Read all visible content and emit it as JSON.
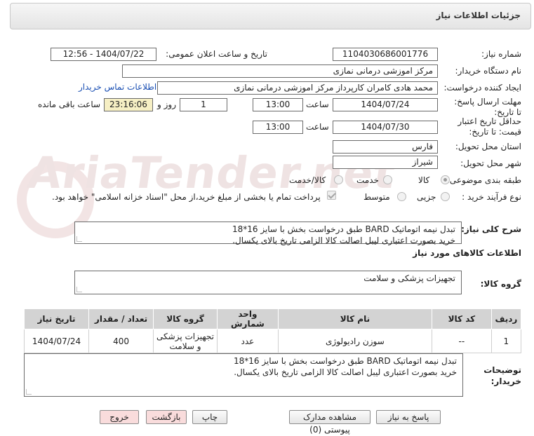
{
  "header": {
    "title": "جزئیات اطلاعات نیاز"
  },
  "watermark": {
    "text": "AriaTender.net"
  },
  "fields": {
    "need_number_label": "شماره نیاز:",
    "need_number": "1104030686001776",
    "announce_label": "تاریخ و ساعت اعلان عمومی:",
    "announce_value": "1404/07/22 - 12:56",
    "buyer_org_label": "نام دستگاه خریدار:",
    "buyer_org": "مرکز اموزشی درمانی نمازی",
    "creator_label": "ایجاد کننده درخواست:",
    "creator": "محمد هادی کامران کارپرداز مرکز اموزشی درمانی نمازی",
    "contact_link": "اطلاعات تماس خریدار",
    "reply_deadline_label": "مهلت ارسال پاسخ: تا تاریخ:",
    "reply_date": "1404/07/24",
    "time_label": "ساعت",
    "reply_time": "13:00",
    "days_value": "1",
    "days_label": "روز و",
    "remaining_time": "23:16:06",
    "remaining_label": "ساعت باقی مانده",
    "validity_label": "حداقل تاریخ اعتبار قیمت: تا تاریخ:",
    "validity_date": "1404/07/30",
    "validity_time": "13:00",
    "province_label": "استان محل تحویل:",
    "province": "فارس",
    "city_label": "شهر محل تحویل:",
    "city": "شیراز",
    "category_label": "طبقه بندی موضوعی:",
    "category_options": [
      "کالا",
      "خدمت",
      "کالا/خدمت"
    ],
    "process_label": "نوع فرآیند خرید :",
    "process_options": [
      "جزیی",
      "متوسط"
    ],
    "payment_note": "پرداخت تمام یا بخشی از مبلغ خرید،از محل \"اسناد خزانه اسلامی\" خواهد بود."
  },
  "summary": {
    "label": "شرح کلی نیاز:",
    "line1": "تبدل نیمه اتوماتیک BARD طبق درخواست بخش با سایز 16*18",
    "line2": "خرید بصورت اعتباری لیبل اصالت کالا الزامی تاریخ بالای یکسال."
  },
  "goods_info": {
    "title": "اطلاعات کالاهای مورد نیاز"
  },
  "goods_group": {
    "label": "گروه کالا:",
    "value": "تجهیزات پزشکی و سلامت"
  },
  "table": {
    "headers": [
      "ردیف",
      "کد کالا",
      "نام کالا",
      "واحد شمارش",
      "گروه کالا",
      "تعداد / مقدار",
      "تاریخ نیاز"
    ],
    "rows": [
      [
        "1",
        "--",
        "سوزن رادیولوژی",
        "عدد",
        "تجهیزات پزشکی و سلامت",
        "400",
        "1404/07/24"
      ]
    ]
  },
  "buyer_notes": {
    "label": "توضیحات خریدار:",
    "line1": "تبدل نیمه اتوماتیک BARD طبق درخواست بخش با سایز 16*18",
    "line2": "خرید بصورت اعتباری لیبل اصالت کالا الزامی تاریخ بالای یکسال."
  },
  "buttons": {
    "reply": "پاسخ به نیاز",
    "attachments": "مشاهده مدارک پیوستی (0)",
    "print": "چاپ",
    "back": "بازگشت",
    "exit": "خروج"
  }
}
